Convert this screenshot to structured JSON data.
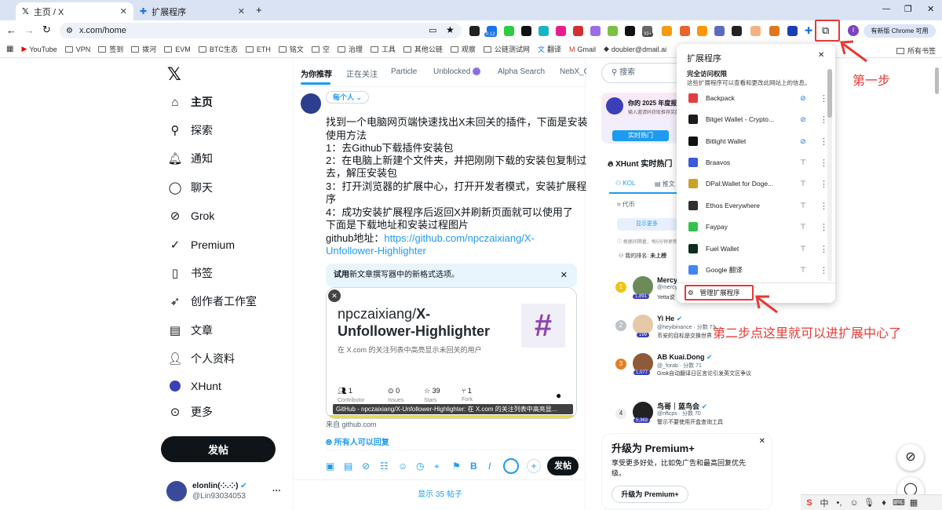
{
  "browser": {
    "tabs": [
      {
        "label": "主页 / X",
        "active": true
      },
      {
        "label": "扩展程序",
        "active": false
      }
    ],
    "new_tab": "+",
    "url": "x.com/home",
    "window_controls": [
      "—",
      "❐",
      "✕"
    ],
    "ext_badges": {
      "e1": "0.12",
      "e2": "99+"
    },
    "profile_letter": "I",
    "chrome_update": "有新版 Chrome 可用"
  },
  "bookmarks": [
    "YouTube",
    "VPN",
    "签到",
    "拨河",
    "EVM",
    "BTC生态",
    "ETH",
    "铭文",
    "空",
    "治理",
    "工具",
    "其他公链",
    "观察",
    "公链测试网",
    "翻译",
    "Gmail",
    "doubler@dmail.ai"
  ],
  "bookmarks_all": "所有书签",
  "nav": {
    "items": [
      "主页",
      "探索",
      "通知",
      "聊天",
      "Grok",
      "Premium",
      "书签",
      "创作者工作室",
      "文章",
      "个人资料",
      "XHunt",
      "更多"
    ],
    "post_button": "发帖",
    "user_name": "elonlin(⁘.⁘)",
    "user_handle": "@Lin93034053",
    "more_dots": "···"
  },
  "main": {
    "tabs": [
      "为你推荐",
      "正在关注",
      "Particle",
      "Unblocked",
      "Alpha Search",
      "NebX_Cl"
    ],
    "audience": "每个人",
    "post_lines": [
      "找到一个电脑网页端快速找出X未回关的插件，下面是安装",
      "使用方法",
      "1：去Github下载插件安装包",
      "2：在电脑上新建个文件夹，并把刚刚下载的安装包复制过",
      "去，解压安装包",
      "3：打开浏览器的扩展中心，打开开发者模式，安装扩展程",
      "序",
      "4：成功安装扩展程序后返回X并刷新页面就可以使用了",
      "下面是下载地址和安装过程图片"
    ],
    "github_label": "github地址：",
    "link_line1": "https://github.com/npczaixiang/X-",
    "link_line2": "Unfollower-Highlighter",
    "hint_strong": "试用",
    "hint_text": "新文章撰写器中的新格式选项。",
    "card_title_prefix": "npczaixiang/",
    "card_title_bold1": "X-",
    "card_title_bold2": "Unfollower-Highlighter",
    "card_desc": "在 X.com 的关注列表中高亮显示未回关的用户",
    "card_stats": [
      {
        "num": "1",
        "label": "Contributor",
        "icon": "people-icon"
      },
      {
        "num": "0",
        "label": "Issues",
        "icon": "issue-icon"
      },
      {
        "num": "39",
        "label": "Stars",
        "icon": "star-icon"
      },
      {
        "num": "1",
        "label": "Fork",
        "icon": "fork-icon"
      }
    ],
    "card_caption": "GitHub - npczaixiang/X-Unfollower-Highlighter: 在 X.com 的关注列表中高亮显...",
    "card_source": "来自 github.com",
    "reply_setting": "所有人可以回复",
    "post_submit": "发帖",
    "show_posts": "显示 35 帖子"
  },
  "right": {
    "search_placeholder": "搜索",
    "promo_title": "你的 2025 年度报",
    "promo_sub": "输入邀请码获取推荐奖励",
    "promo_btn": "实时热门",
    "xhunt_title": "XHunt 实时热门",
    "tab_kol": "KOL",
    "tab_push": "推文",
    "token": "代币",
    "more_btn": "显示更多",
    "notice": "根据间隔量，每5分钟更新",
    "my_rank_label": "我的排名:",
    "my_rank_value": "未上榜",
    "people": [
      {
        "rank": "1",
        "name": "Mercy",
        "handle": "@mercy",
        "desc": "Yetta说",
        "score": "1,891"
      },
      {
        "rank": "2",
        "name": "Yi He",
        "handle": "@heyibinance · 分数 73",
        "desc": "币安的目标是交换世界",
        "score": "199"
      },
      {
        "rank": "3",
        "name": "AB Kuai.Dong",
        "handle": "@_forab · 分数 71",
        "desc": "Grok自动翻译日区言论引发英文区争议",
        "score": "1,077"
      },
      {
        "rank": "4",
        "name": "鸟哥｜蓝鸟会",
        "handle": "@nftcps · 分数 70",
        "desc": "警示不要使用开盒查询工具",
        "score": "5,363"
      }
    ],
    "premium_title": "升级为 Premium+",
    "premium_desc_1": "享受更多好处，比如免广告和最高回复优先",
    "premium_desc_2": "级。",
    "premium_btn": "升级为 Premium+"
  },
  "popup": {
    "title": "扩展程序",
    "section": "完全访问权限",
    "section_desc": "这些扩展程序可以查看和更改此网站上的信息。",
    "extensions": [
      {
        "name": "Backpack",
        "color": "#e33e3f",
        "pinned": false
      },
      {
        "name": "Bitget Wallet - Crypto...",
        "color": "#1c1c1c",
        "pinned": false
      },
      {
        "name": "Bitlight Wallet",
        "color": "#111111",
        "pinned": false
      },
      {
        "name": "Braavos",
        "color": "#3b5bdb",
        "pinned": true
      },
      {
        "name": "DPal:Wallet for Doge...",
        "color": "#c9a227",
        "pinned": true
      },
      {
        "name": "Ethos Everywhere",
        "color": "#2f2f2f",
        "pinned": true
      },
      {
        "name": "Faypay",
        "color": "#35c24a",
        "pinned": true
      },
      {
        "name": "Fuel Wallet",
        "color": "#0d2e1f",
        "pinned": true
      },
      {
        "name": "Google 翻译",
        "color": "#4285f4",
        "pinned": true
      }
    ],
    "manage": "管理扩展程序"
  },
  "annotations": {
    "step1": "第一步",
    "step2": "第二步点这里就可以进扩展中心了"
  },
  "colors": {
    "accent": "#1d9bf0",
    "red": "#e53935",
    "chrome_tab": "#d9e3f4"
  }
}
